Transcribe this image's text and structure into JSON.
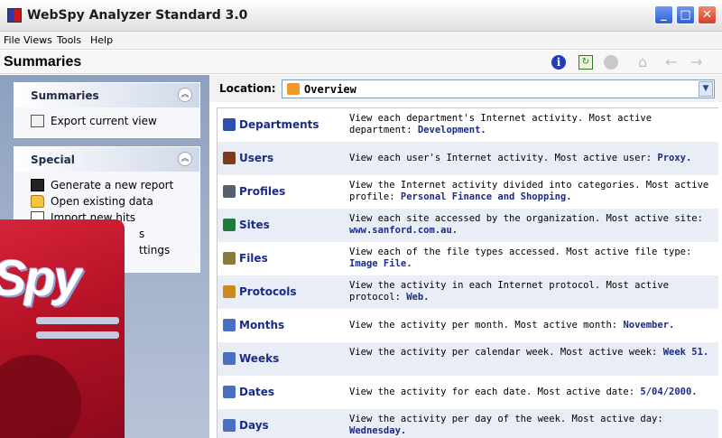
{
  "window": {
    "title": "WebSpy Analyzer Standard 3.0",
    "controls": {
      "minimize": "_",
      "maximize": "□",
      "close": "✕"
    }
  },
  "menubar": {
    "items": [
      "File",
      "Views",
      "Tools",
      "Help"
    ]
  },
  "header": {
    "title": "Summaries",
    "toolbar_icons": [
      "info-icon",
      "report-icon",
      "stop-icon",
      "home-icon",
      "back-icon",
      "forward-icon"
    ]
  },
  "sidebar": {
    "panels": [
      {
        "title": "Summaries",
        "tasks": [
          {
            "label": "Export current view",
            "icon": "export-icon"
          }
        ]
      },
      {
        "title": "Special",
        "tasks": [
          {
            "label": "Generate a new report",
            "icon": "generate-report-icon"
          },
          {
            "label": "Open existing data",
            "icon": "open-folder-icon"
          },
          {
            "label": "Import new hits",
            "icon": "import-icon"
          },
          {
            "label": "s",
            "icon": ""
          },
          {
            "label": "ttings",
            "icon": ""
          }
        ]
      }
    ]
  },
  "box_art": {
    "logo": "Spy"
  },
  "location": {
    "label": "Location:",
    "value": "Overview"
  },
  "summaries": [
    {
      "name": "Departments",
      "icon": "departments-icon",
      "desc": "View each department's Internet activity.  Most active department: ",
      "active": "Development."
    },
    {
      "name": "Users",
      "icon": "users-icon",
      "desc": "View each user's Internet activity.  Most active user: ",
      "active": "Proxy."
    },
    {
      "name": "Profiles",
      "icon": "profiles-icon",
      "desc": "View the Internet activity divided into categories.  Most active profile: ",
      "active": "Personal Finance and Shopping."
    },
    {
      "name": "Sites",
      "icon": "globe-icon",
      "desc": "View each site accessed by the organization.  Most active site: ",
      "active": "www.sanford.com.au."
    },
    {
      "name": "Files",
      "icon": "files-icon",
      "desc": "View each of the file types accessed.  Most active file type: ",
      "active": "Image File."
    },
    {
      "name": "Protocols",
      "icon": "protocols-icon",
      "desc": "View the activity in each Internet protocol.  Most active protocol: ",
      "active": "Web."
    },
    {
      "name": "Months",
      "icon": "calendar-icon",
      "desc": "View the activity per month.  Most active month: ",
      "active": "November."
    },
    {
      "name": "Weeks",
      "icon": "calendar-icon",
      "desc": "View the activity per calendar week.  Most active week: ",
      "active": "Week 51."
    },
    {
      "name": "Dates",
      "icon": "calendar-icon",
      "desc": "View the activity for each date.  Most active date: ",
      "active": "5/04/2000."
    },
    {
      "name": "Days",
      "icon": "calendar-icon",
      "desc": "View the activity per day of the week.  Most active day: ",
      "active": "Wednesday."
    }
  ],
  "colors": {
    "link": "#1a2b86",
    "sidebar_gradient_top": "#8ea0bf",
    "row_alt": "#e9edf6",
    "box_red": "#b51226"
  }
}
